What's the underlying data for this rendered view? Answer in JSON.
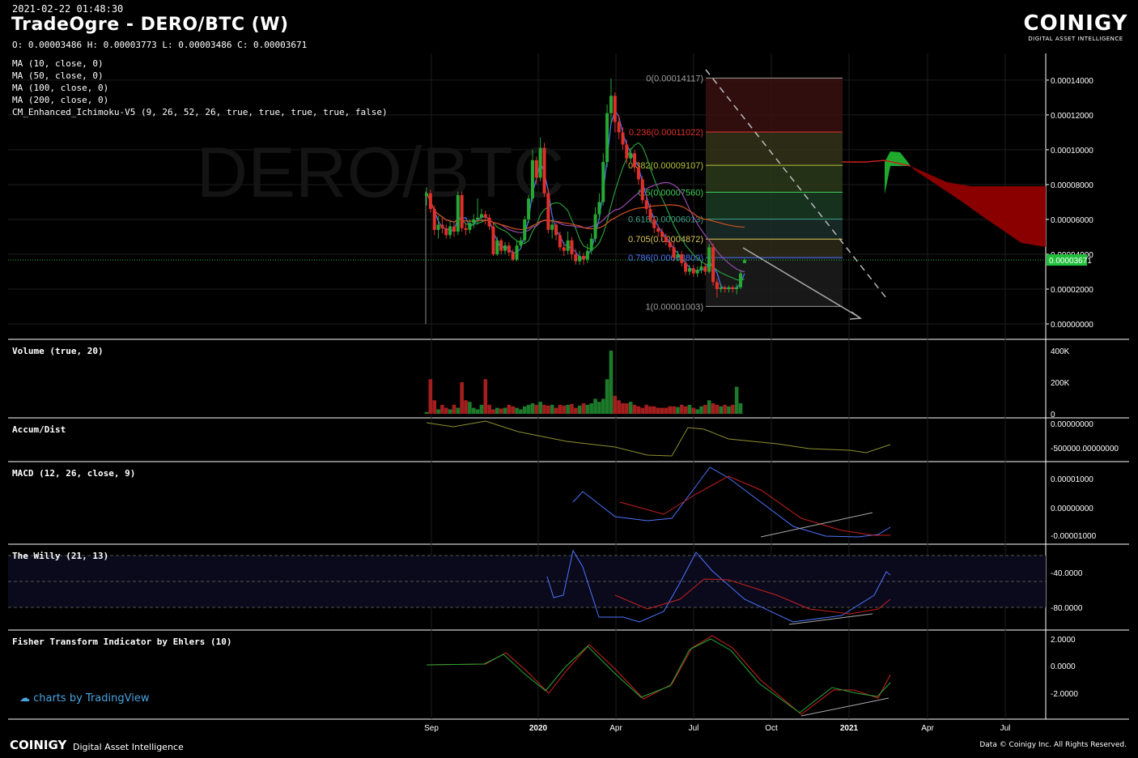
{
  "header": {
    "timestamp": "2021-02-22 01:48:30",
    "title": "TradeOgre - DERO/BTC (W)",
    "ohlc": "O: 0.00003486 H: 0.00003773 L: 0.00003486 C: 0.00003671",
    "indicators": [
      "MA (10, close, 0)",
      "MA (50, close, 0)",
      "MA (100, close, 0)",
      "MA (200, close, 0)",
      "CM_Enhanced_Ichimoku-V5 (9, 26, 52, 26, true, true, true, true, false)"
    ]
  },
  "brand": {
    "name": "COINIGY",
    "tagline": "DIGITAL ASSET INTELLIGENCE"
  },
  "watermark": "DERO/BTC",
  "tradingview": "charts by TradingView",
  "footer": {
    "logo": "COINIGY",
    "tagline": "Digital Asset Intelligence",
    "credit": "Data © Coinigy Inc.  All Rights Reserved."
  },
  "colors": {
    "up": "#26a834",
    "down": "#e0302a",
    "accent": "#1fbf3a",
    "blue": "#4d74ff"
  },
  "panes": {
    "volume": "Volume (true, 20)",
    "accum": "Accum/Dist",
    "macd": "MACD (12, 26, close, 9)",
    "willy": "The Willy (21, 13)",
    "fisher": "Fisher Transform Indicator by Ehlers (10)"
  },
  "chart_data": {
    "type": "candlestick",
    "x_ticks": [
      "Sep",
      "2020",
      "Apr",
      "Jul",
      "Oct",
      "2021",
      "Apr",
      "Jul"
    ],
    "price_ticks": [
      "0.00014000",
      "0.00012000",
      "0.00010000",
      "0.00008000",
      "0.00006000",
      "0.00004000",
      "0.00002000",
      "0.00000000"
    ],
    "price_ylim": [
      0,
      0.000146
    ],
    "last_price": "0.00003671",
    "fib_levels": [
      {
        "label": "0(0.00014117)",
        "value": 0.00014117,
        "color": "#9b9b9b"
      },
      {
        "label": "0.236(0.00011022)",
        "value": 0.00011022,
        "color": "#e0302a"
      },
      {
        "label": "0.382(0.00009107)",
        "value": 9.107e-05,
        "color": "#b5c33b"
      },
      {
        "label": "0.5(0.00007560)",
        "value": 7.56e-05,
        "color": "#3fd058"
      },
      {
        "label": "0.618(0.00006013)",
        "value": 6.013e-05,
        "color": "#3fa38a"
      },
      {
        "label": "0.705(0.00004872)",
        "value": 4.872e-05,
        "color": "#d9c35a"
      },
      {
        "label": "0.786(0.00003809)",
        "value": 3.809e-05,
        "color": "#4d74ff"
      },
      {
        "label": "1(0.00001003)",
        "value": 1.003e-05,
        "color": "#9b9b9b"
      }
    ],
    "candles": [
      [
        7.35e-05,
        7.5e-05,
        6.8e-05,
        7.85e-05
      ],
      [
        7.5e-05,
        6.6e-05,
        6.4e-05,
        7.7e-05
      ],
      [
        6.6e-05,
        5.4e-05,
        5.1e-05,
        6.8e-05
      ],
      [
        5.4e-05,
        5.7e-05,
        4.9e-05,
        6.2e-05
      ],
      [
        5.7e-05,
        5.5e-05,
        5.2e-05,
        6.1e-05
      ],
      [
        5.5e-05,
        5.1e-05,
        4.9e-05,
        5.7e-05
      ],
      [
        5.1e-05,
        5.6e-05,
        4.9e-05,
        5.9e-05
      ],
      [
        5.6e-05,
        5.3e-05,
        5e-05,
        5.8e-05
      ],
      [
        5.3e-05,
        7.4e-05,
        5.1e-05,
        7.6e-05
      ],
      [
        7.4e-05,
        5.5e-05,
        5.3e-05,
        7.6e-05
      ],
      [
        5.5e-05,
        5.4e-05,
        5.1e-05,
        5.8e-05
      ],
      [
        5.4e-05,
        5.8e-05,
        5.2e-05,
        6e-05
      ],
      [
        5.8e-05,
        6e-05,
        5.5e-05,
        6.3e-05
      ],
      [
        6e-05,
        6.1e-05,
        5.7e-05,
        7.2e-05
      ],
      [
        6.1e-05,
        6.3e-05,
        5.9e-05,
        6.6e-05
      ],
      [
        6.3e-05,
        6.1e-05,
        5.7e-05,
        6.5e-05
      ],
      [
        6.1e-05,
        5.6e-05,
        5.4e-05,
        6.3e-05
      ],
      [
        5.6e-05,
        4e-05,
        3.9e-05,
        5.8e-05
      ],
      [
        4e-05,
        4.8e-05,
        3.9e-05,
        5e-05
      ],
      [
        4.8e-05,
        4.2e-05,
        4e-05,
        4.9e-05
      ],
      [
        4.2e-05,
        4.5e-05,
        4e-05,
        4.7e-05
      ],
      [
        4.5e-05,
        4.1e-05,
        3.9e-05,
        4.7e-05
      ],
      [
        4.1e-05,
        3.7e-05,
        3.6e-05,
        4.3e-05
      ],
      [
        3.7e-05,
        4.5e-05,
        3.6e-05,
        4.8e-05
      ],
      [
        4.5e-05,
        4.8e-05,
        4.3e-05,
        5e-05
      ],
      [
        4.8e-05,
        6e-05,
        4.6e-05,
        6.2e-05
      ],
      [
        6e-05,
        7.2e-05,
        5.8e-05,
        7.4e-05
      ],
      [
        7.2e-05,
        9.4e-05,
        7e-05,
        0.0001
      ],
      [
        9.4e-05,
        8.4e-05,
        8e-05,
        9.6e-05
      ],
      [
        8.4e-05,
        0.000101,
        8.2e-05,
        0.000107
      ],
      [
        0.000101,
        7.5e-05,
        7.3e-05,
        0.000104
      ],
      [
        7.5e-05,
        5.4e-05,
        5.2e-05,
        7.8e-05
      ],
      [
        5.4e-05,
        5.7e-05,
        4.9e-05,
        6e-05
      ],
      [
        5.7e-05,
        5.1e-05,
        4.8e-05,
        5.9e-05
      ],
      [
        5.1e-05,
        4.4e-05,
        4.2e-05,
        5.3e-05
      ],
      [
        4.4e-05,
        4.2e-05,
        3.9e-05,
        4.7e-05
      ],
      [
        4.2e-05,
        4.8e-05,
        4e-05,
        5.3e-05
      ],
      [
        4.8e-05,
        4e-05,
        3.7e-05,
        5e-05
      ],
      [
        4e-05,
        3.6e-05,
        3.4e-05,
        4.3e-05
      ],
      [
        3.6e-05,
        3.9e-05,
        3.4e-05,
        4.2e-05
      ],
      [
        3.9e-05,
        3.7e-05,
        3.4e-05,
        4.1e-05
      ],
      [
        3.7e-05,
        4.2e-05,
        3.5e-05,
        4.6e-05
      ],
      [
        4.2e-05,
        4.9e-05,
        4e-05,
        5.2e-05
      ],
      [
        4.9e-05,
        6.3e-05,
        4.7e-05,
        6.7e-05
      ],
      [
        6.3e-05,
        7e-05,
        6e-05,
        7.5e-05
      ],
      [
        7e-05,
        9.3e-05,
        6.8e-05,
        9.8e-05
      ],
      [
        9.3e-05,
        0.000121,
        9e-05,
        0.000126
      ],
      [
        0.000121,
        0.000131,
        0.000115,
        0.000141
      ],
      [
        0.000131,
        0.000116,
        0.00011,
        0.000133
      ],
      [
        0.000116,
        0.00011,
        0.000106,
        0.00012
      ],
      [
        0.00011,
        0.000103,
        0.0001,
        0.000113
      ],
      [
        0.000103,
        9.5e-05,
        9.2e-05,
        0.000106
      ],
      [
        9.5e-05,
        9.8e-05,
        9.3e-05,
        0.000101
      ],
      [
        9.8e-05,
        9e-05,
        8.7e-05,
        0.0001
      ],
      [
        9e-05,
        8.3e-05,
        8e-05,
        9.3e-05
      ],
      [
        8.3e-05,
        7.1e-05,
        6.9e-05,
        8.5e-05
      ],
      [
        7.1e-05,
        6.6e-05,
        6.3e-05,
        7.4e-05
      ],
      [
        6.6e-05,
        6e-05,
        5.8e-05,
        6.9e-05
      ],
      [
        6e-05,
        5.5e-05,
        5.2e-05,
        6.2e-05
      ],
      [
        5.5e-05,
        5.3e-05,
        5e-05,
        5.7e-05
      ],
      [
        5.3e-05,
        5e-05,
        4.8e-05,
        5.5e-05
      ],
      [
        5e-05,
        4.7e-05,
        4.5e-05,
        5.2e-05
      ],
      [
        4.7e-05,
        4.4e-05,
        4.2e-05,
        4.9e-05
      ],
      [
        4.4e-05,
        3.8e-05,
        3.6e-05,
        4.7e-05
      ],
      [
        3.8e-05,
        4e-05,
        3.6e-05,
        4.2e-05
      ],
      [
        4e-05,
        3.5e-05,
        3.3e-05,
        4.2e-05
      ],
      [
        3.5e-05,
        3e-05,
        2.8e-05,
        3.7e-05
      ],
      [
        3e-05,
        3.2e-05,
        2.8e-05,
        3.4e-05
      ],
      [
        3.2e-05,
        2.9e-05,
        2.7e-05,
        3.4e-05
      ],
      [
        2.9e-05,
        3.1e-05,
        2.7e-05,
        3.3e-05
      ],
      [
        3.1e-05,
        3.3e-05,
        2.9e-05,
        3.6e-05
      ],
      [
        3.3e-05,
        3e-05,
        2.8e-05,
        3.5e-05
      ],
      [
        3e-05,
        4.4e-05,
        2.9e-05,
        4.6e-05
      ],
      [
        4.4e-05,
        2.4e-05,
        2.2e-05,
        4.6e-05
      ],
      [
        2.4e-05,
        2e-05,
        1.5e-05,
        2.6e-05
      ],
      [
        2e-05,
        2.1e-05,
        1.8e-05,
        2.3e-05
      ],
      [
        2.1e-05,
        2e-05,
        1.8e-05,
        2.2e-05
      ],
      [
        2e-05,
        2.1e-05,
        1.8e-05,
        2.2e-05
      ],
      [
        2.1e-05,
        2e-05,
        1.8e-05,
        2.2e-05
      ],
      [
        2e-05,
        2.1e-05,
        1.7e-05,
        2.3e-05
      ],
      [
        2.1e-05,
        2.9e-05,
        2e-05,
        3.1e-05
      ],
      [
        3.49e-05,
        3.67e-05,
        3.49e-05,
        3.77e-05
      ]
    ],
    "volumes": [
      12,
      230,
      90,
      30,
      60,
      40,
      30,
      60,
      40,
      210,
      90,
      80,
      40,
      30,
      60,
      230,
      60,
      30,
      40,
      35,
      40,
      60,
      50,
      40,
      30,
      50,
      60,
      70,
      60,
      80,
      60,
      55,
      60,
      40,
      60,
      55,
      60,
      65,
      40,
      55,
      70,
      60,
      70,
      100,
      80,
      100,
      230,
      420,
      120,
      90,
      70,
      70,
      80,
      60,
      50,
      40,
      60,
      50,
      50,
      40,
      40,
      40,
      50,
      50,
      45,
      60,
      50,
      60,
      40,
      30,
      50,
      60,
      90,
      70,
      60,
      50,
      60,
      50,
      60,
      180,
      70
    ]
  }
}
